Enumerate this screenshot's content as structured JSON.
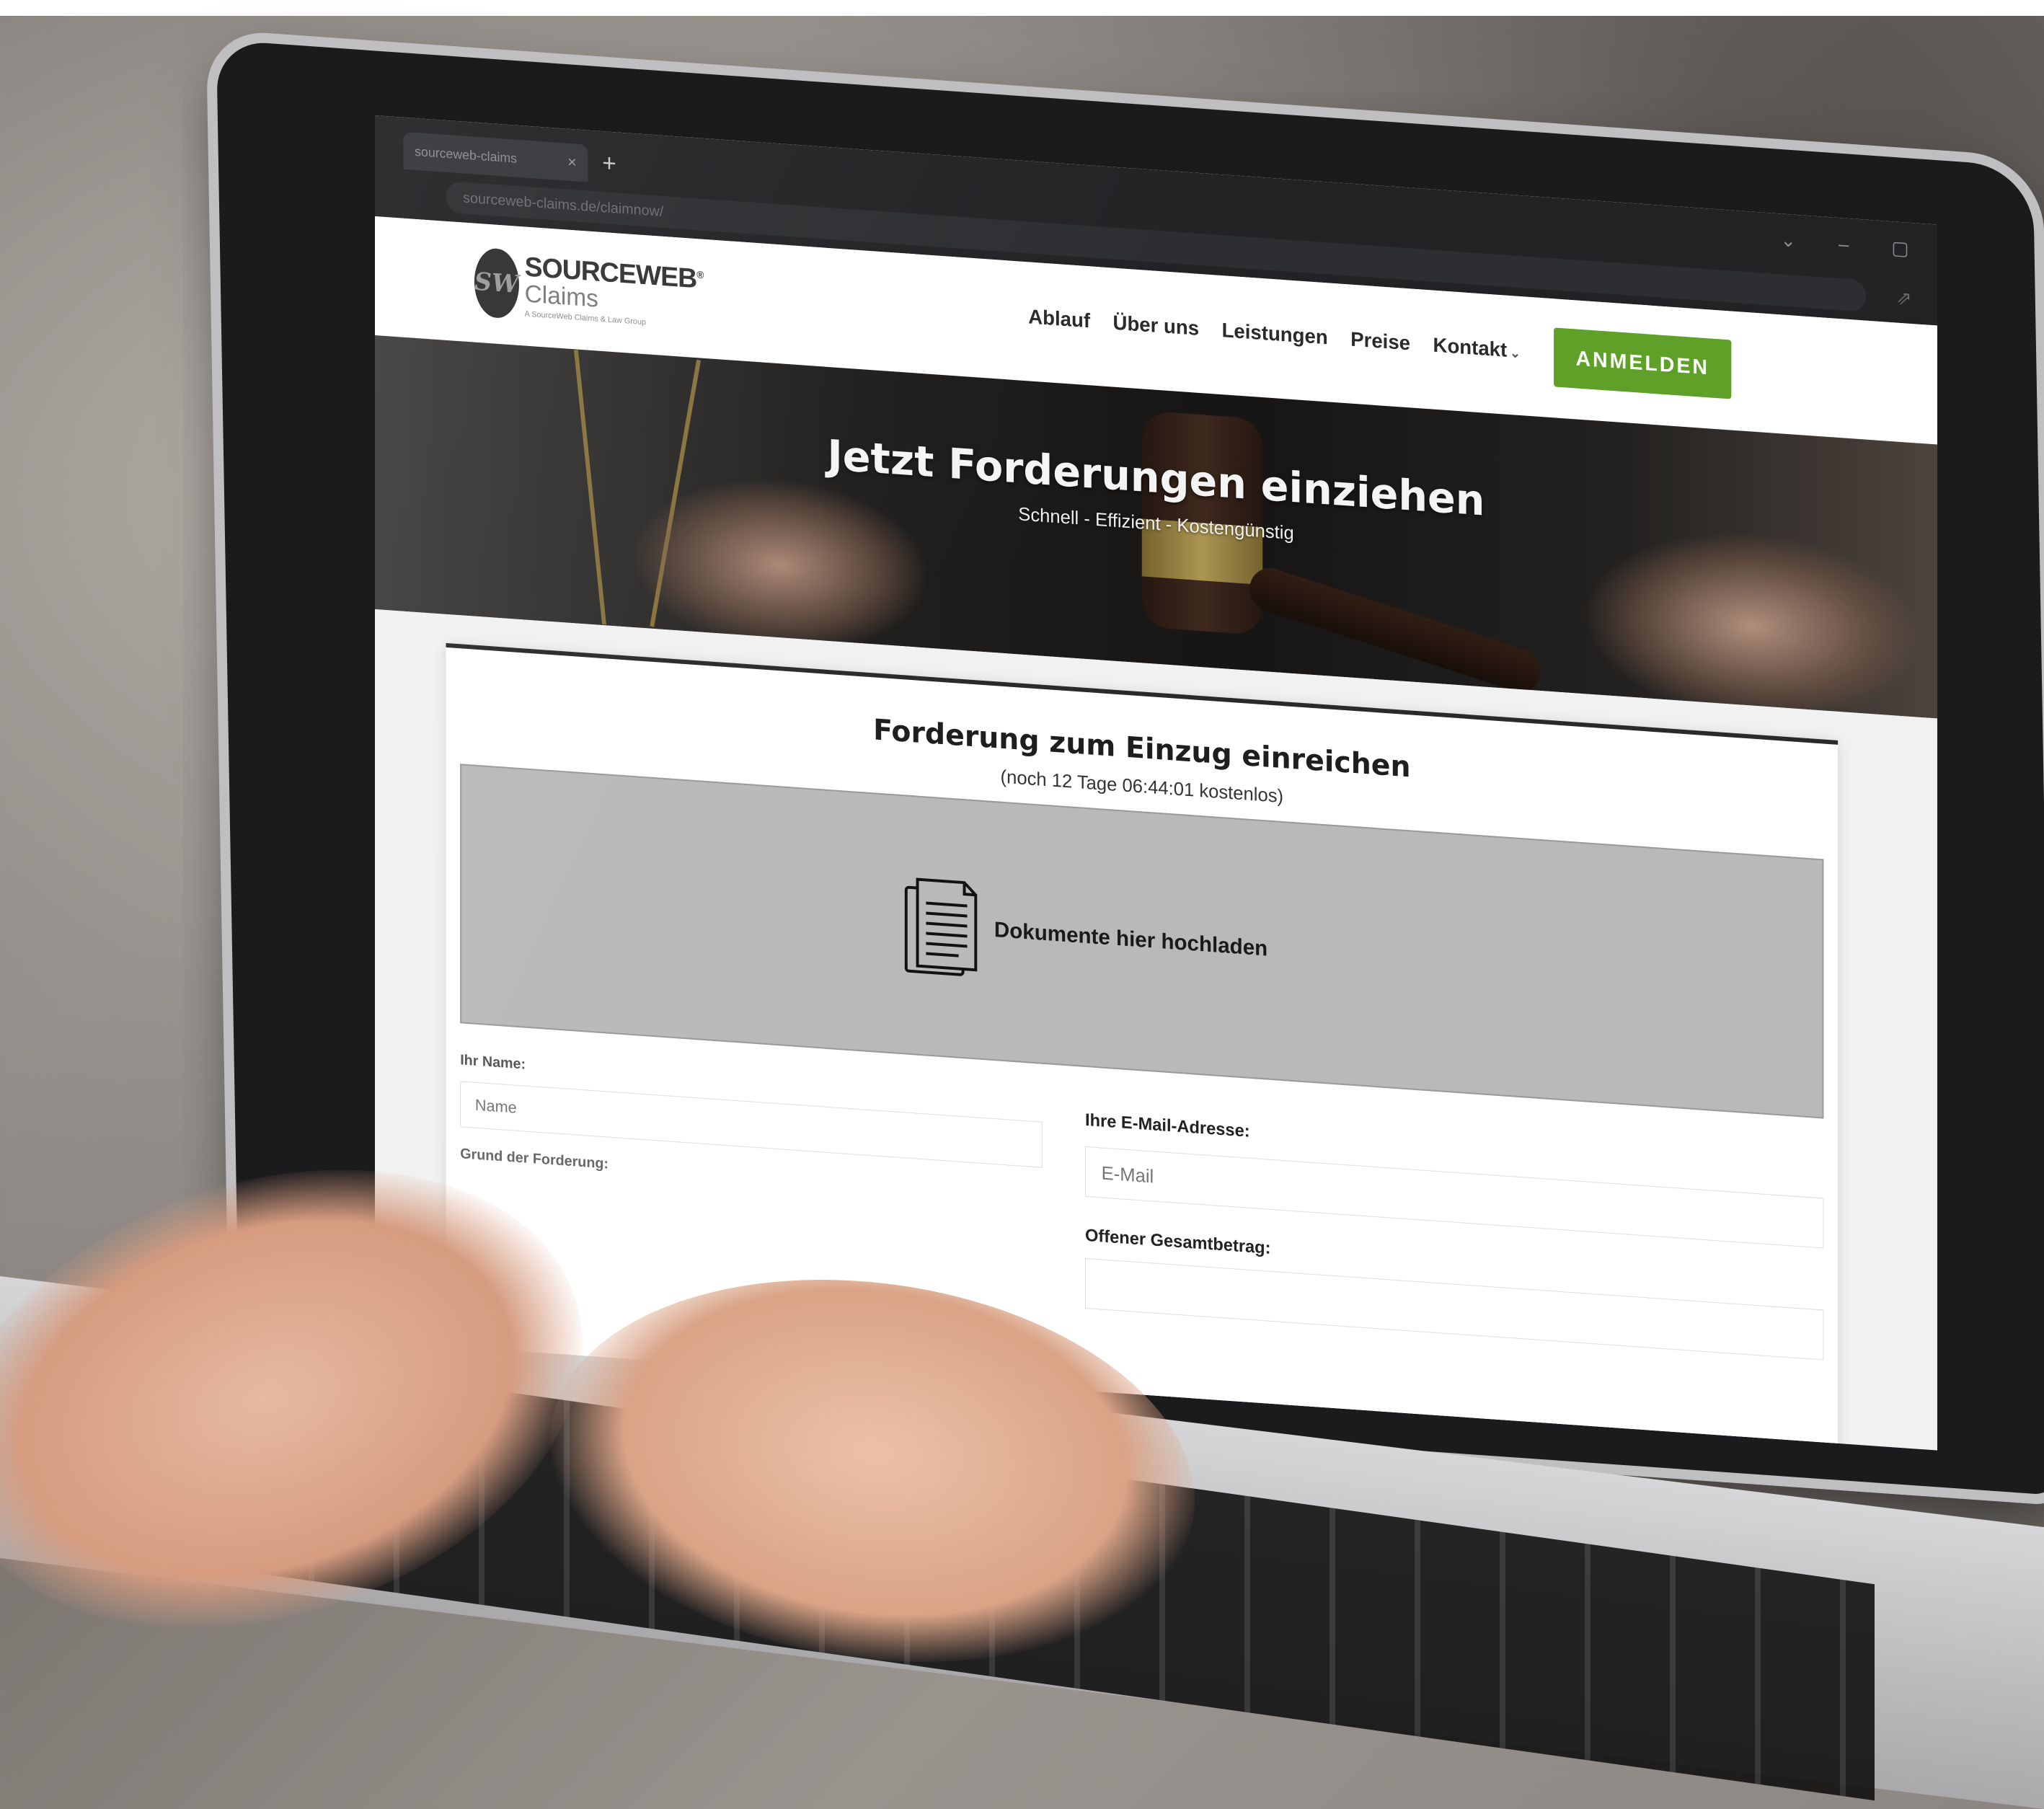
{
  "browser": {
    "tab_title": "sourceweb-claims",
    "tab_close": "×",
    "new_tab": "+",
    "controls": {
      "chevron": "⌄",
      "minimize": "–",
      "maximize": "▢"
    },
    "url_domain": "sourceweb-claims.de",
    "url_path": "/claimnow/",
    "share_icon": "⇗"
  },
  "header": {
    "logo_mark": "SW",
    "logo_name": "SOURCEWEB",
    "logo_reg": "®",
    "logo_sub": "Claims",
    "logo_tagline": "A SourceWeb Claims & Law Group",
    "nav": [
      "Ablauf",
      "Über uns",
      "Leistungen",
      "Preise",
      "Kontakt"
    ],
    "nav_chevron": "⌄",
    "login_label": "ANMELDEN"
  },
  "hero": {
    "title": "Jetzt Forderungen einziehen",
    "subtitle": "Schnell - Effizient - Kostengünstig"
  },
  "form": {
    "title": "Forderung zum Einzug einreichen",
    "subtitle": "(noch 12 Tage 06:44:01 kostenlos)",
    "dropzone_label": "Dokumente hier hochladen",
    "name_label": "Ihr Name:",
    "name_placeholder": "Name",
    "claim_label": "Grund der Forderung:",
    "email_label": "Ihre E-Mail-Adresse:",
    "email_placeholder": "E-Mail",
    "total_label": "Offener Gesamtbetrag:"
  },
  "colors": {
    "accent": "#5fa028",
    "header_bg": "#ffffff",
    "dropzone": "#b9b9b9"
  }
}
